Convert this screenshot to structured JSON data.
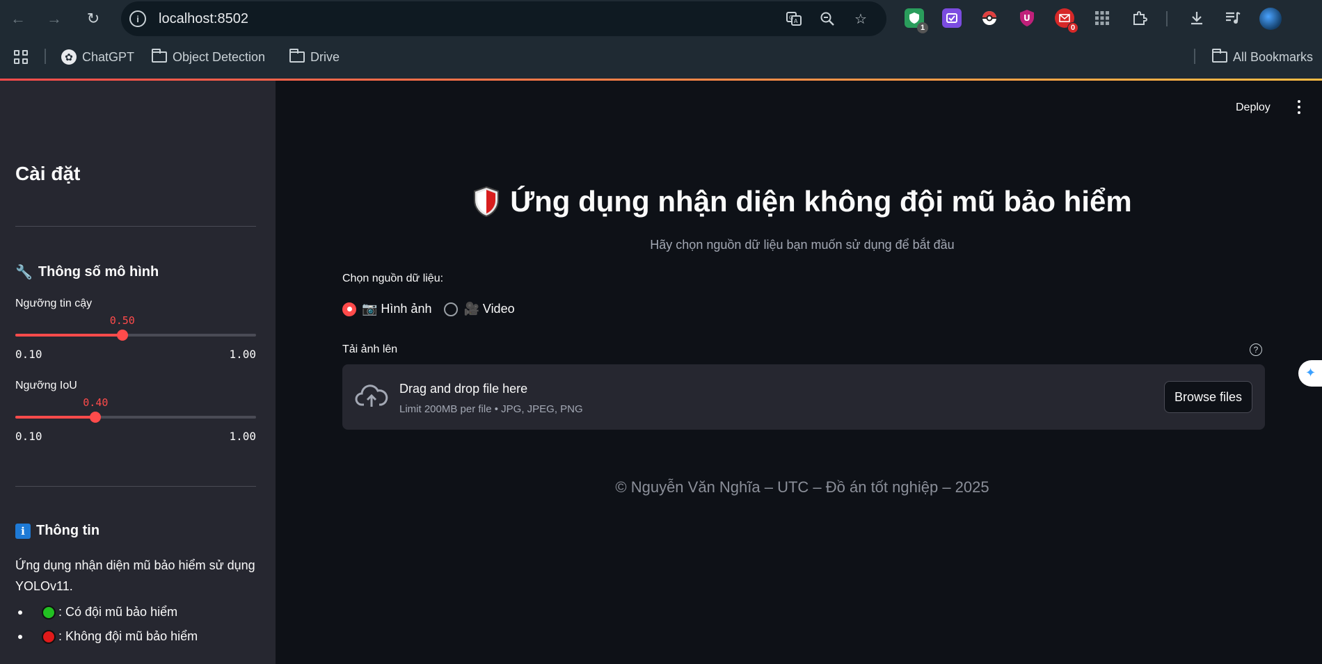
{
  "browser": {
    "url": "localhost:8502",
    "extensions": [
      {
        "name": "ext-shield",
        "color": "#2a9d5c",
        "badge": "1",
        "badge_color": "#555"
      },
      {
        "name": "ext-purple",
        "color": "#7b4ce0",
        "badge": "",
        "badge_color": ""
      },
      {
        "name": "ext-pokeball",
        "color": "#e04040",
        "badge": "",
        "badge_color": ""
      },
      {
        "name": "ext-ublock",
        "color": "#c0207a",
        "badge": "",
        "badge_color": ""
      },
      {
        "name": "ext-mail",
        "color": "#d62828",
        "badge": "0",
        "badge_color": "#d62828"
      }
    ],
    "bookmarks": {
      "chatgpt": "ChatGPT",
      "object_detection": "Object Detection",
      "drive": "Drive",
      "all_bookmarks": "All Bookmarks"
    }
  },
  "sidebar": {
    "title": "Cài đặt",
    "model_params": {
      "heading": "Thông số mô hình",
      "heading_icon": "🔧",
      "confidence": {
        "label": "Ngưỡng tin cậy",
        "value": 0.5,
        "value_text": "0.50",
        "min": "0.10",
        "max": "1.00"
      },
      "iou": {
        "label": "Ngưỡng IoU",
        "value": 0.4,
        "value_text": "0.40",
        "min": "0.10",
        "max": "1.00"
      }
    },
    "info": {
      "heading": "Thông tin",
      "heading_icon": "ℹ",
      "description": "Ứng dụng nhận diện mũ bảo hiểm sử dụng YOLOv11.",
      "legend": [
        {
          "color": "#22c022",
          "text": ": Có đội mũ bảo hiểm"
        },
        {
          "color": "#e01a1a",
          "text": ": Không đội mũ bảo hiểm"
        }
      ]
    }
  },
  "main": {
    "deploy": "Deploy",
    "title": "Ứng dụng nhận diện không đội mũ bảo hiểm",
    "subtitle": "Hãy chọn nguồn dữ liệu bạn muốn sử dụng để bắt đầu",
    "source_label": "Chọn nguồn dữ liệu:",
    "options": [
      {
        "label": "📷 Hình ảnh",
        "selected": true
      },
      {
        "label": "🎥 Video",
        "selected": false
      }
    ],
    "upload_label": "Tải ảnh lên",
    "dropzone": {
      "title": "Drag and drop file here",
      "limit": "Limit 200MB per file • JPG, JPEG, PNG",
      "button": "Browse files"
    },
    "footer": "© Nguyễn Văn Nghĩa – UTC – Đồ án tốt nghiệp – 2025"
  }
}
